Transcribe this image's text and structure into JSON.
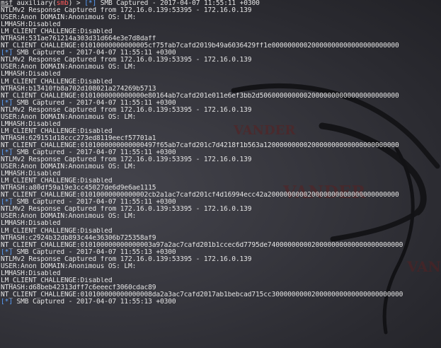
{
  "terminal": {
    "prompt": {
      "msf": "msf",
      "module_prefix": "auxiliary(",
      "module": "smb",
      "module_suffix": ")",
      "arrow": " > "
    },
    "watermark": "VANDER",
    "lines": [
      {
        "kind": "prompt_header",
        "tag": "[*]",
        "text": " SMB Captured - 2017-04-07 11:55:11 +0300"
      },
      {
        "kind": "text",
        "text": "NTLMv2 Response Captured from 172.16.0.139:53395 - 172.16.0.139"
      },
      {
        "kind": "text",
        "text": "USER:Anon DOMAIN:Anonimous OS: LM:"
      },
      {
        "kind": "text",
        "text": "LMHASH:Disabled"
      },
      {
        "kind": "text",
        "text": "LM_CLIENT_CHALLENGE:Disabled"
      },
      {
        "kind": "text",
        "text": "NTHASH:531ae761214a303d31d664e3e7d8daff"
      },
      {
        "kind": "text",
        "text": "NT_CLIENT_CHALLENGE:01010000000000005cf75fab7cafd2019b49a6036429ff1e00000000020000000000000000000000"
      },
      {
        "kind": "status",
        "tag": "[*]",
        "text": " SMB Captured - 2017-04-07 11:55:11 +0300"
      },
      {
        "kind": "text",
        "text": "NTLMv2 Response Captured from 172.16.0.139:53395 - 172.16.0.139"
      },
      {
        "kind": "text",
        "text": "USER:Anon DOMAIN:Anonimous OS: LM:"
      },
      {
        "kind": "text",
        "text": "LMHASH:Disabled"
      },
      {
        "kind": "text",
        "text": "LM_CLIENT_CHALLENGE:Disabled"
      },
      {
        "kind": "text",
        "text": "NTHASH:b13410fb8a702d108021a274269b5713"
      },
      {
        "kind": "text",
        "text": "NT_CLIENT_CHALLENGE:0101000000000000e80164ab7cafd201e011e6ef3bb2d50600000000020000000000000000000000"
      },
      {
        "kind": "status",
        "tag": "[*]",
        "text": " SMB Captured - 2017-04-07 11:55:11 +0300"
      },
      {
        "kind": "text",
        "text": "NTLMv2 Response Captured from 172.16.0.139:53395 - 172.16.0.139"
      },
      {
        "kind": "text",
        "text": "USER:Anon DOMAIN:Anonimous OS: LM:"
      },
      {
        "kind": "text",
        "text": "LMHASH:Disabled"
      },
      {
        "kind": "text",
        "text": "LM_CLIENT_CHALLENGE:Disabled"
      },
      {
        "kind": "text",
        "text": "NTHASH:629151d18ccc273ed8119eecf57701a1"
      },
      {
        "kind": "text",
        "text": "NT_CLIENT_CHALLENGE:0101000000000000497f65ab7cafd201c7d4218f1b563a1200000000020000000000000000000000"
      },
      {
        "kind": "status",
        "tag": "[*]",
        "text": " SMB Captured - 2017-04-07 11:55:11 +0300"
      },
      {
        "kind": "text",
        "text": "NTLMv2 Response Captured from 172.16.0.139:53395 - 172.16.0.139"
      },
      {
        "kind": "text",
        "text": "USER:Anon DOMAIN:Anonimous OS: LM:"
      },
      {
        "kind": "text",
        "text": "LMHASH:Disabled"
      },
      {
        "kind": "text",
        "text": "LM_CLIENT_CHALLENGE:Disabled"
      },
      {
        "kind": "text",
        "text": "NTHASH:a80df59a19e3cc45027de6d9e6ae1115"
      },
      {
        "kind": "text",
        "text": "NT_CLIENT_CHALLENGE:01010000000000002cb2a1ac7cafd201cf4d16994ecc42a200000000020000000000000000000000"
      },
      {
        "kind": "status",
        "tag": "[*]",
        "text": " SMB Captured - 2017-04-07 11:55:11 +0300"
      },
      {
        "kind": "text",
        "text": "NTLMv2 Response Captured from 172.16.0.139:53395 - 172.16.0.139"
      },
      {
        "kind": "text",
        "text": "USER:Anon DOMAIN:Anonimous OS: LM:"
      },
      {
        "kind": "text",
        "text": "LMHASH:Disabled"
      },
      {
        "kind": "text",
        "text": "LM_CLIENT_CHALLENGE:Disabled"
      },
      {
        "kind": "text",
        "text": "NTHASH:c2924b32db893c44e36306b725358af9"
      },
      {
        "kind": "text",
        "text": "NT_CLIENT_CHALLENGE:010100000000000003a97a2ac7cafd201b1ccec6d7795de7400000000020000000000000000000000"
      },
      {
        "kind": "status",
        "tag": "[*]",
        "text": " SMB Captured - 2017-04-07 11:55:13 +0300"
      },
      {
        "kind": "text",
        "text": "NTLMv2 Response Captured from 172.16.0.139:53395 - 172.16.0.139"
      },
      {
        "kind": "text",
        "text": "USER:Anon DOMAIN:Anonimous OS: LM:"
      },
      {
        "kind": "text",
        "text": "LMHASH:Disabled"
      },
      {
        "kind": "text",
        "text": "LM_CLIENT_CHALLENGE:Disabled"
      },
      {
        "kind": "text",
        "text": "NTHASH:d68beb42313dff7c6eeecf3060cdac89"
      },
      {
        "kind": "text",
        "text": "NT_CLIENT_CHALLENGE:010100000000000008da2a3ac7cafd2017ab1bebcad715cc300000000020000000000000000000000"
      },
      {
        "kind": "status",
        "tag": "[*]",
        "text": " SMB Captured - 2017-04-07 11:55:13 +0300"
      }
    ]
  },
  "colors": {
    "tag": "#5aa2ff",
    "text": "#e4e4e4",
    "module": "#ff5a5a",
    "background": "#2e2e34"
  }
}
